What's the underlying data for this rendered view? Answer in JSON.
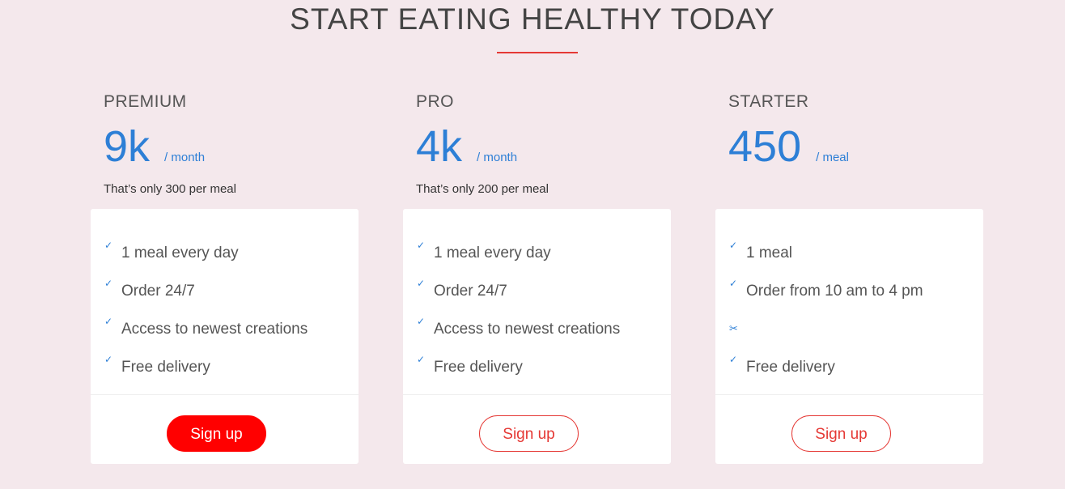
{
  "page": {
    "title": "START EATING HEALTHY TODAY",
    "accent_color": "#e53935",
    "price_color": "#2d7fd6"
  },
  "plans": [
    {
      "name": "PREMIUM",
      "price": "9k",
      "per": "/ month",
      "note": "That’s only 300 per meal",
      "features": [
        {
          "icon": "check-icon",
          "mark": "✓",
          "text": "1 meal every day"
        },
        {
          "icon": "check-icon",
          "mark": "✓",
          "text": "Order 24/7"
        },
        {
          "icon": "check-icon",
          "mark": "✓",
          "text": "Access to newest creations"
        },
        {
          "icon": "check-icon",
          "mark": "✓",
          "text": "Free delivery"
        }
      ],
      "button_label": "Sign up"
    },
    {
      "name": "PRO",
      "price": "4k",
      "per": "/ month",
      "note": "That’s only 200 per meal",
      "features": [
        {
          "icon": "check-icon",
          "mark": "✓",
          "text": "1 meal every day"
        },
        {
          "icon": "check-icon",
          "mark": "✓",
          "text": "Order 24/7"
        },
        {
          "icon": "check-icon",
          "mark": "✓",
          "text": "Access to newest creations"
        },
        {
          "icon": "check-icon",
          "mark": "✓",
          "text": "Free delivery"
        }
      ],
      "button_label": "Sign up"
    },
    {
      "name": "STARTER",
      "price": "450",
      "per": "/ meal",
      "note": "",
      "features": [
        {
          "icon": "check-icon",
          "mark": "✓",
          "text": "1 meal"
        },
        {
          "icon": "check-icon",
          "mark": "✓",
          "text": "Order from 10 am to 4 pm"
        },
        {
          "icon": "scissors-icon",
          "mark": "✂",
          "text": ""
        },
        {
          "icon": "check-icon",
          "mark": "✓",
          "text": "Free delivery"
        }
      ],
      "button_label": "Sign up"
    }
  ]
}
